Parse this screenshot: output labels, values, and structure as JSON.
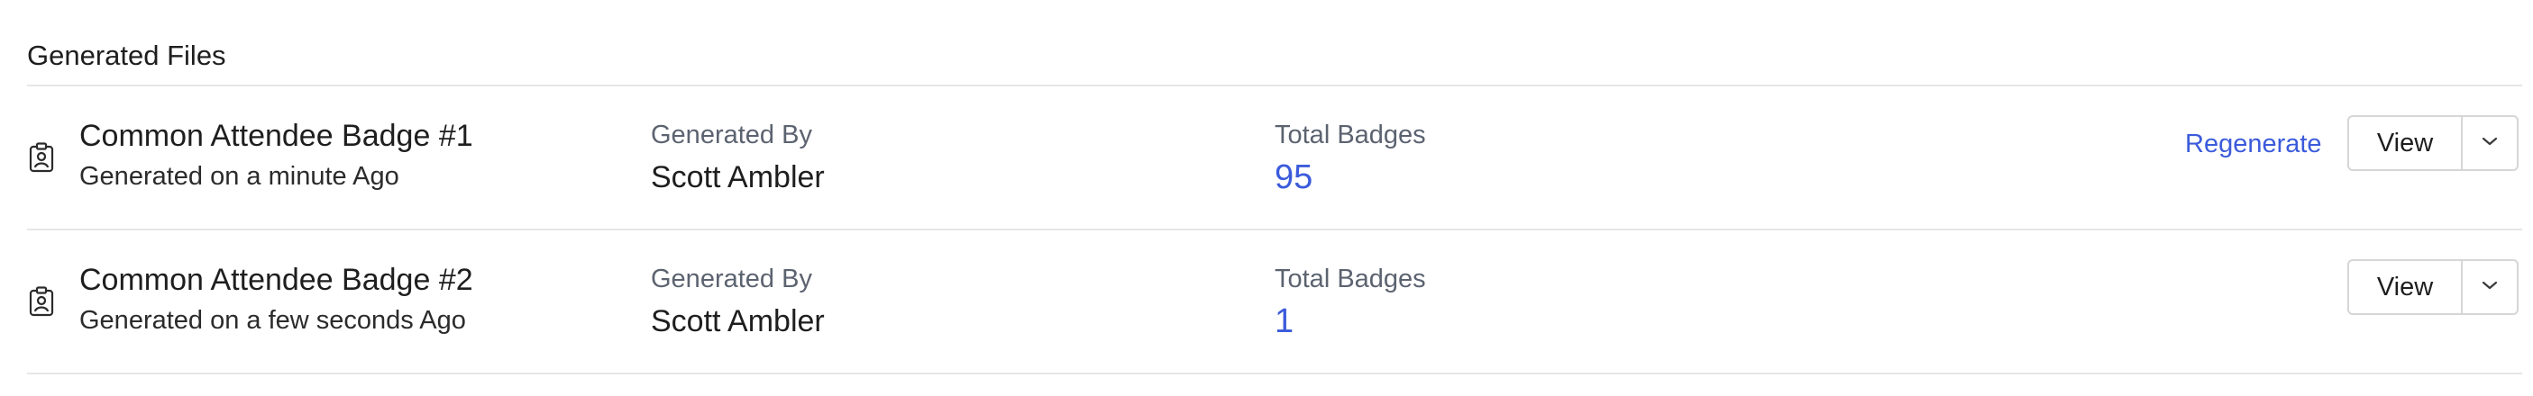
{
  "section": {
    "title": "Generated Files"
  },
  "files": [
    {
      "name": "Common Attendee Badge #1",
      "generated_on": "Generated on a minute Ago",
      "generated_by_label": "Generated By",
      "generated_by": "Scott Ambler",
      "total_badges_label": "Total Badges",
      "total_badges": "95",
      "regenerate_label": "Regenerate",
      "view_label": "View",
      "icon": "id-badge-icon"
    },
    {
      "name": "Common Attendee Badge #2",
      "generated_on": "Generated on a few seconds Ago",
      "generated_by_label": "Generated By",
      "generated_by": "Scott Ambler",
      "total_badges_label": "Total Badges",
      "total_badges": "1",
      "view_label": "View",
      "icon": "id-badge-icon"
    }
  ],
  "colors": {
    "accent": "#3b5bdb",
    "divider": "#e6e6e6",
    "label": "#5c6370"
  }
}
